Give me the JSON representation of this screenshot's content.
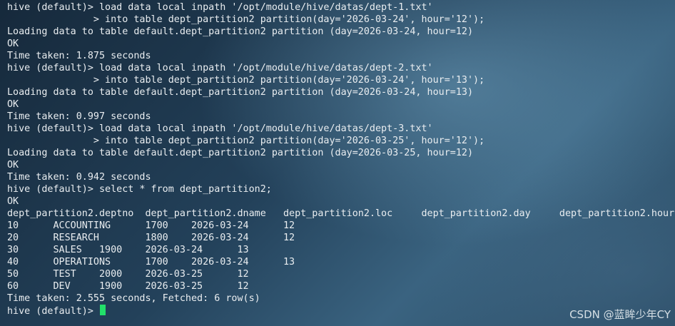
{
  "terminal": {
    "lines": [
      "hive (default)> load data local inpath '/opt/module/hive/datas/dept-1.txt'",
      "               > into table dept_partition2 partition(day='2026-03-24', hour='12');",
      "Loading data to table default.dept_partition2 partition (day=2026-03-24, hour=12)",
      "OK",
      "Time taken: 1.875 seconds",
      "hive (default)> load data local inpath '/opt/module/hive/datas/dept-2.txt'",
      "               > into table dept_partition2 partition(day='2026-03-24', hour='13');",
      "Loading data to table default.dept_partition2 partition (day=2026-03-24, hour=13)",
      "OK",
      "Time taken: 0.997 seconds",
      "hive (default)> load data local inpath '/opt/module/hive/datas/dept-3.txt'",
      "               > into table dept_partition2 partition(day='2026-03-25', hour='12');",
      "Loading data to table default.dept_partition2 partition (day=2026-03-25, hour=12)",
      "OK",
      "Time taken: 0.942 seconds",
      "hive (default)> select * from dept_partition2;",
      "OK",
      "dept_partition2.deptno  dept_partition2.dname   dept_partition2.loc     dept_partition2.day     dept_partition2.hour",
      "10      ACCOUNTING      1700    2026-03-24      12",
      "20      RESEARCH        1800    2026-03-24      12",
      "30      SALES   1900    2026-03-24      13",
      "40      OPERATIONS      1700    2026-03-24      13",
      "50      TEST    2000    2026-03-25      12",
      "60      DEV     1900    2026-03-25      12",
      "Time taken: 2.555 seconds, Fetched: 6 row(s)"
    ],
    "prompt": "hive (default)> "
  },
  "watermark": "CSDN @蓝眸少年CY",
  "colors": {
    "text": "#e9edf0",
    "cursor": "#22e06a"
  }
}
